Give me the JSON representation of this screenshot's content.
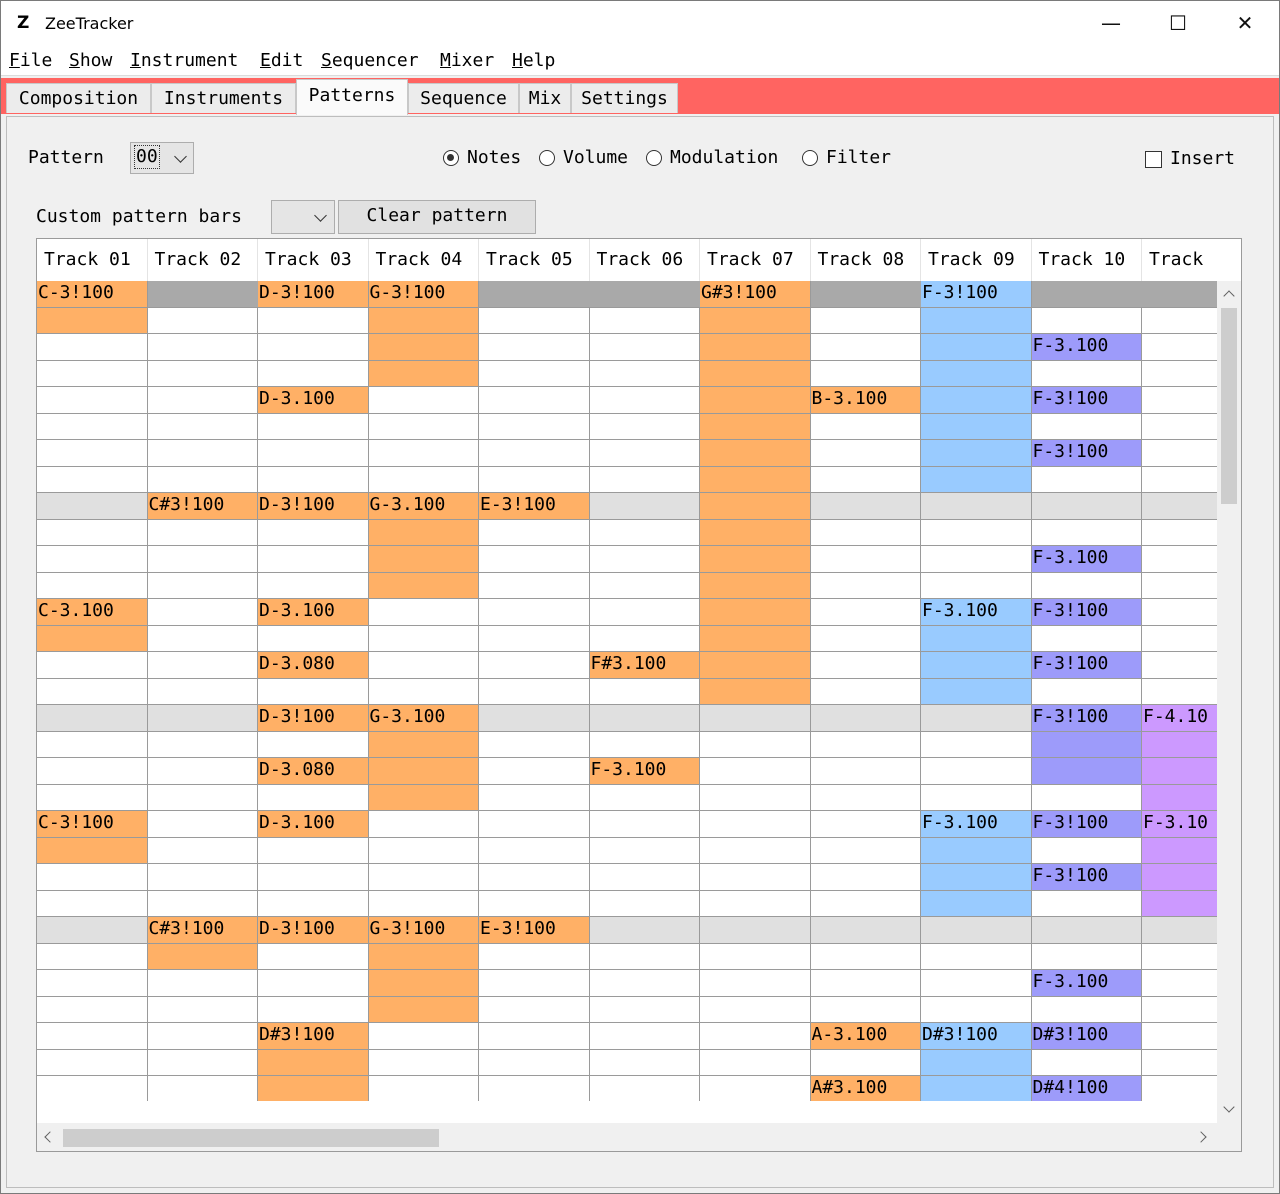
{
  "window": {
    "title": "ZeeTracker",
    "icon": "Z",
    "minimize": "—",
    "maximize": "☐",
    "close": "✕"
  },
  "menu": [
    "File",
    "Show",
    "Instrument",
    "Edit",
    "Sequencer",
    "Mixer",
    "Help"
  ],
  "tabs": [
    "Composition",
    "Instruments",
    "Patterns",
    "Sequence",
    "Mix",
    "Settings"
  ],
  "active_tab": 2,
  "controls": {
    "pattern_label": "Pattern",
    "pattern_value": "00",
    "modes": [
      "Notes",
      "Volume",
      "Modulation",
      "Filter"
    ],
    "selected_mode": 0,
    "insert_label": "Insert",
    "insert_checked": false,
    "custom_bars_label": "Custom pattern bars",
    "clear_button": "Clear pattern"
  },
  "colors": {
    "orange": "#ffb066",
    "blue": "#99cbff",
    "purple": "#9d9bfa",
    "lavender": "#cc99ff",
    "gray_header": "#a9a9a9",
    "gray_band": "#e0e0e0",
    "tab_strip": "#ff6461"
  },
  "tracks": [
    "Track 01",
    "Track 02",
    "Track 03",
    "Track 04",
    "Track 05",
    "Track 06",
    "Track 07",
    "Track 08",
    "Track 09",
    "Track 10",
    "Track"
  ],
  "rows": [
    [
      "C-3!100",
      "",
      "D-3!100",
      "G-3!100",
      "",
      "",
      "G#3!100",
      "",
      "F-3!100",
      "",
      ""
    ],
    [
      "",
      "",
      "",
      "",
      "",
      "",
      "",
      "",
      "",
      "",
      ""
    ],
    [
      "",
      "",
      "",
      "",
      "",
      "",
      "",
      "",
      "",
      "F-3.100",
      ""
    ],
    [
      "",
      "",
      "",
      "",
      "",
      "",
      "",
      "",
      "",
      "",
      ""
    ],
    [
      "",
      "",
      "D-3.100",
      "",
      "",
      "",
      "",
      "B-3.100",
      "",
      "F-3!100",
      ""
    ],
    [
      "",
      "",
      "",
      "",
      "",
      "",
      "",
      "",
      "",
      "",
      ""
    ],
    [
      "",
      "",
      "",
      "",
      "",
      "",
      "",
      "",
      "",
      "F-3!100",
      ""
    ],
    [
      "",
      "",
      "",
      "",
      "",
      "",
      "",
      "",
      "",
      "",
      ""
    ],
    [
      "",
      "C#3!100",
      "D-3!100",
      "G-3.100",
      "E-3!100",
      "",
      "",
      "",
      "",
      "",
      ""
    ],
    [
      "",
      "",
      "",
      "",
      "",
      "",
      "",
      "",
      "",
      "",
      ""
    ],
    [
      "",
      "",
      "",
      "",
      "",
      "",
      "",
      "",
      "",
      "F-3.100",
      ""
    ],
    [
      "",
      "",
      "",
      "",
      "",
      "",
      "",
      "",
      "",
      "",
      ""
    ],
    [
      "C-3.100",
      "",
      "D-3.100",
      "",
      "",
      "",
      "",
      "",
      "F-3.100",
      "F-3!100",
      ""
    ],
    [
      "",
      "",
      "",
      "",
      "",
      "",
      "",
      "",
      "",
      "",
      ""
    ],
    [
      "",
      "",
      "D-3.080",
      "",
      "",
      "F#3.100",
      "",
      "",
      "",
      "F-3!100",
      ""
    ],
    [
      "",
      "",
      "",
      "",
      "",
      "",
      "",
      "",
      "",
      "",
      ""
    ],
    [
      "",
      "",
      "D-3!100",
      "G-3.100",
      "",
      "",
      "",
      "",
      "",
      "F-3!100",
      "F-4.10"
    ],
    [
      "",
      "",
      "",
      "",
      "",
      "",
      "",
      "",
      "",
      "",
      ""
    ],
    [
      "",
      "",
      "D-3.080",
      "",
      "",
      "F-3.100",
      "",
      "",
      "",
      "",
      ""
    ],
    [
      "",
      "",
      "",
      "",
      "",
      "",
      "",
      "",
      "",
      "",
      ""
    ],
    [
      "C-3!100",
      "",
      "D-3.100",
      "",
      "",
      "",
      "",
      "",
      "F-3.100",
      "F-3!100",
      "F-3.10"
    ],
    [
      "",
      "",
      "",
      "",
      "",
      "",
      "",
      "",
      "",
      "",
      ""
    ],
    [
      "",
      "",
      "",
      "",
      "",
      "",
      "",
      "",
      "",
      "F-3!100",
      ""
    ],
    [
      "",
      "",
      "",
      "",
      "",
      "",
      "",
      "",
      "",
      "",
      ""
    ],
    [
      "",
      "C#3!100",
      "D-3!100",
      "G-3!100",
      "E-3!100",
      "",
      "",
      "",
      "",
      "",
      ""
    ],
    [
      "",
      "",
      "",
      "",
      "",
      "",
      "",
      "",
      "",
      "",
      ""
    ],
    [
      "",
      "",
      "",
      "",
      "",
      "",
      "",
      "",
      "",
      "F-3.100",
      ""
    ],
    [
      "",
      "",
      "",
      "",
      "",
      "",
      "",
      "",
      "",
      "",
      ""
    ],
    [
      "",
      "",
      "D#3!100",
      "",
      "",
      "",
      "",
      "A-3.100",
      "D#3!100",
      "D#3!100",
      ""
    ],
    [
      "",
      "",
      "",
      "",
      "",
      "",
      "",
      "",
      "",
      "",
      ""
    ],
    [
      "",
      "",
      "",
      "",
      "",
      "",
      "",
      "A#3.100",
      "",
      "D#4!100",
      ""
    ]
  ],
  "row_fills": [
    [
      "orange",
      "gray",
      "orange",
      "orange",
      "gray",
      "gray",
      "orange",
      "gray",
      "blue",
      "gray",
      "gray"
    ],
    [
      "orange",
      "",
      "",
      "orange",
      "",
      "",
      "orange",
      "",
      "blue",
      "",
      ""
    ],
    [
      "",
      "",
      "",
      "orange",
      "",
      "",
      "orange",
      "",
      "blue",
      "purple",
      ""
    ],
    [
      "",
      "",
      "",
      "orange",
      "",
      "",
      "orange",
      "",
      "blue",
      "",
      ""
    ],
    [
      "",
      "",
      "orange",
      "",
      "",
      "",
      "orange",
      "orange",
      "blue",
      "purple",
      ""
    ],
    [
      "",
      "",
      "",
      "",
      "",
      "",
      "orange",
      "",
      "blue",
      "",
      ""
    ],
    [
      "",
      "",
      "",
      "",
      "",
      "",
      "orange",
      "",
      "blue",
      "purple",
      ""
    ],
    [
      "",
      "",
      "",
      "",
      "",
      "",
      "orange",
      "",
      "blue",
      "",
      ""
    ],
    [
      "band",
      "orange",
      "orange",
      "orange",
      "orange",
      "band",
      "orange",
      "band",
      "band",
      "band",
      "band"
    ],
    [
      "",
      "",
      "",
      "orange",
      "",
      "",
      "orange",
      "",
      "",
      "",
      ""
    ],
    [
      "",
      "",
      "",
      "orange",
      "",
      "",
      "orange",
      "",
      "",
      "purple",
      ""
    ],
    [
      "",
      "",
      "",
      "orange",
      "",
      "",
      "orange",
      "",
      "",
      "",
      ""
    ],
    [
      "orange",
      "",
      "orange",
      "",
      "",
      "",
      "orange",
      "",
      "blue",
      "purple",
      ""
    ],
    [
      "orange",
      "",
      "",
      "",
      "",
      "",
      "orange",
      "",
      "blue",
      "",
      ""
    ],
    [
      "",
      "",
      "orange",
      "",
      "",
      "orange",
      "orange",
      "",
      "blue",
      "purple",
      ""
    ],
    [
      "",
      "",
      "",
      "",
      "",
      "",
      "orange",
      "",
      "blue",
      "",
      ""
    ],
    [
      "band",
      "band",
      "orange",
      "orange",
      "band",
      "band",
      "band",
      "band",
      "band",
      "purple",
      "lavender"
    ],
    [
      "",
      "",
      "",
      "orange",
      "",
      "",
      "",
      "",
      "",
      "purple",
      "lavender"
    ],
    [
      "",
      "",
      "orange",
      "orange",
      "",
      "orange",
      "",
      "",
      "",
      "purple",
      "lavender"
    ],
    [
      "",
      "",
      "",
      "orange",
      "",
      "",
      "",
      "",
      "",
      "",
      "lavender"
    ],
    [
      "orange",
      "",
      "orange",
      "",
      "",
      "",
      "",
      "",
      "blue",
      "purple",
      "lavender"
    ],
    [
      "orange",
      "",
      "",
      "",
      "",
      "",
      "",
      "",
      "blue",
      "",
      "lavender"
    ],
    [
      "",
      "",
      "",
      "",
      "",
      "",
      "",
      "",
      "blue",
      "purple",
      "lavender"
    ],
    [
      "",
      "",
      "",
      "",
      "",
      "",
      "",
      "",
      "blue",
      "",
      "lavender"
    ],
    [
      "band",
      "orange",
      "orange",
      "orange",
      "orange",
      "band",
      "band",
      "band",
      "band",
      "band",
      "band"
    ],
    [
      "",
      "orange",
      "",
      "orange",
      "",
      "",
      "",
      "",
      "",
      "",
      ""
    ],
    [
      "",
      "",
      "",
      "orange",
      "",
      "",
      "",
      "",
      "",
      "purple",
      ""
    ],
    [
      "",
      "",
      "",
      "orange",
      "",
      "",
      "",
      "",
      "",
      "",
      ""
    ],
    [
      "",
      "",
      "orange",
      "",
      "",
      "",
      "",
      "orange",
      "blue",
      "purple",
      ""
    ],
    [
      "",
      "",
      "orange",
      "",
      "",
      "",
      "",
      "",
      "blue",
      "",
      ""
    ],
    [
      "",
      "",
      "orange",
      "",
      "",
      "",
      "",
      "orange",
      "blue",
      "purple",
      ""
    ]
  ]
}
